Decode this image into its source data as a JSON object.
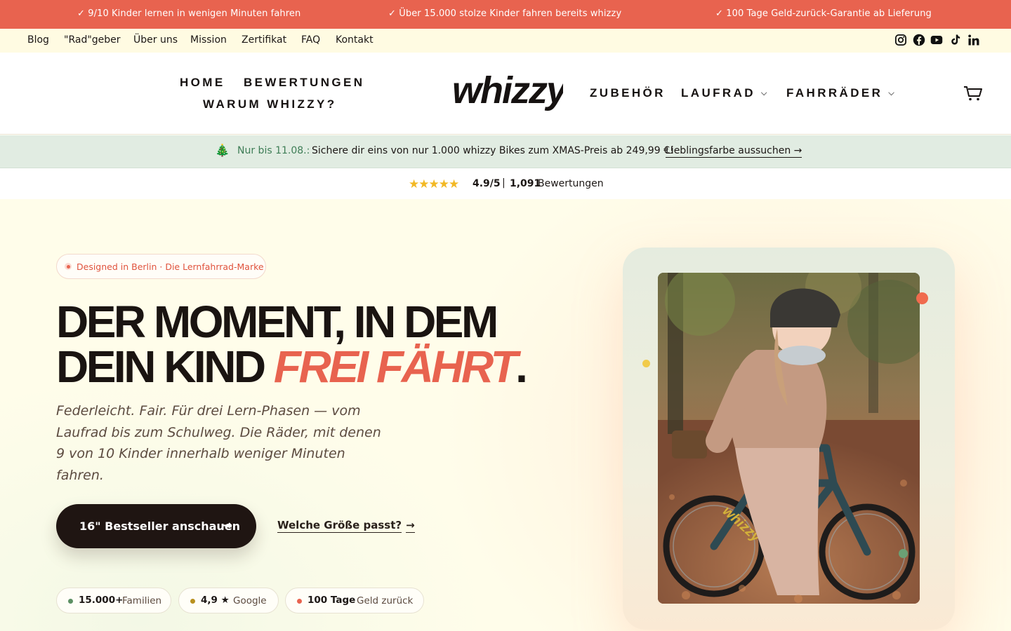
{
  "announcement": [
    "✓ 9/10 Kinder lernen in wenigen Minuten fahren",
    "✓ Über 15.000 stolze Kinder fahren bereits whizzy",
    "✓ 100 Tage Geld-zurück-Garantie ab Lieferung"
  ],
  "utility_nav": [
    "Blog",
    "\"Rad\"geber",
    "Über uns",
    "Mission",
    "Zertifikat",
    "FAQ",
    "Kontakt"
  ],
  "social_icons": [
    "instagram-icon",
    "facebook-icon",
    "youtube-icon",
    "tiktok-icon",
    "linkedin-icon"
  ],
  "header": {
    "logo": "whizzy",
    "nav_left": [
      "HOME",
      "BEWERTUNGEN",
      "WARUM WHIZZY?"
    ],
    "nav_right": [
      "ZUBEHÖR",
      "LAUFRAD",
      "FAHRRÄDER"
    ],
    "cart_icon": "cart-icon"
  },
  "promo": {
    "icon": "🎄",
    "date": "Nur bis 11.08.:",
    "text": "Sichere dir eins von nur 1.000 whizzy Bikes zum XMAS-Preis ab 249,99 €!",
    "link": "Lieblingsfarbe aussuchen →"
  },
  "rating": {
    "stars": "★★★★★",
    "score": "4.9/5",
    "separator": "|",
    "count": "1,091",
    "label": "Bewertungen",
    "star_color": "#f2b824"
  },
  "hero": {
    "badge": "Designed in Berlin · Die Lernfahrrad-Marke",
    "headline_line1": "DER MOMENT, IN DEM",
    "headline_line2": "DEIN KIND ",
    "headline_accent": "FREI FÄHRT",
    "headline_end": ".",
    "subtitle": "Federleicht. Fair. Für drei Lern-Phasen — vom Laufrad bis zum Schulweg. Die Räder, mit denen 9 von 10 Kinder innerhalb weniger Minuten fahren.",
    "cta": "16\" Bestseller anschauen",
    "cta_arrow": "→",
    "secondary_link": "Welche Größe passt?",
    "secondary_arrow": "→",
    "stats": [
      {
        "value": "15.000+",
        "label": "Familien",
        "color": "#5c8f63"
      },
      {
        "value": "4,9 ★",
        "label": "Google",
        "color": "#b8901e"
      },
      {
        "value": "100 Tage",
        "label": "Geld zurück",
        "color": "#e8634f"
      }
    ]
  },
  "colors": {
    "accent": "#e8634f",
    "dark": "#1f1512",
    "promo_bg": "#e1ece2",
    "utility_bg": "#fffbe2"
  }
}
